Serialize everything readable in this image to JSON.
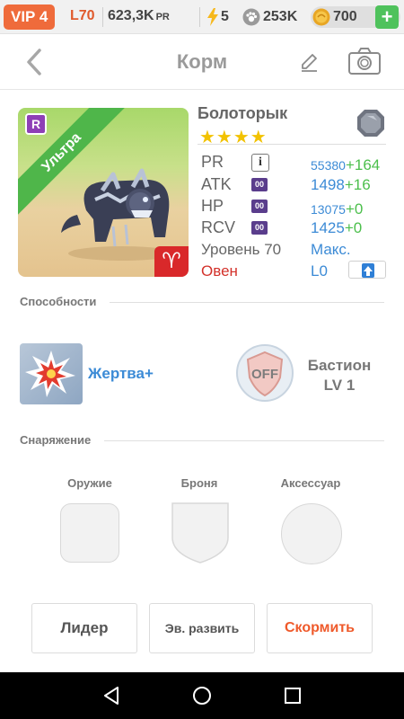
{
  "topbar": {
    "vip": "VIP 4",
    "level": "L70",
    "pr_value": "623,3K",
    "pr_unit": "PR",
    "energy": "5",
    "paw": "253K",
    "coins": "700",
    "plus": "+"
  },
  "header": {
    "title": "Корм"
  },
  "monster": {
    "rank": "R",
    "ribbon": "Ультра",
    "name": "Болоторык",
    "stars": "★★★★",
    "zodiac_symbol": "♈",
    "stats": {
      "pr": {
        "label": "PR",
        "value": "55380",
        "bonus": "+164"
      },
      "atk": {
        "label": "ATK",
        "badge": "00",
        "value": "1498",
        "bonus": "+16"
      },
      "hp": {
        "label": "HP",
        "badge": "00",
        "value": "13075",
        "bonus": "+0"
      },
      "rcv": {
        "label": "RCV",
        "badge": "00",
        "value": "1425",
        "bonus": "+0"
      }
    },
    "level_label": "Уровень 70",
    "level_value": "Макс.",
    "sign_label": "Овен",
    "sign_value": "L0"
  },
  "abilities": {
    "header": "Способности",
    "skill_name": "Жертва+",
    "off_label": "OFF",
    "passive_name": "Бастион",
    "passive_level": "LV 1"
  },
  "equipment": {
    "header": "Снаряжение",
    "weapon": "Оружие",
    "armor": "Броня",
    "accessory": "Аксессуар"
  },
  "buttons": {
    "leader": "Лидер",
    "evolve": "Эв. развить",
    "feed": "Скормить"
  },
  "colors": {
    "accent_orange": "#ef6b3b",
    "blue_value": "#3c8bd6",
    "green_bonus": "#4cbf4c",
    "red_sign": "#d3322b",
    "ribbon_green": "#4fb64a"
  }
}
